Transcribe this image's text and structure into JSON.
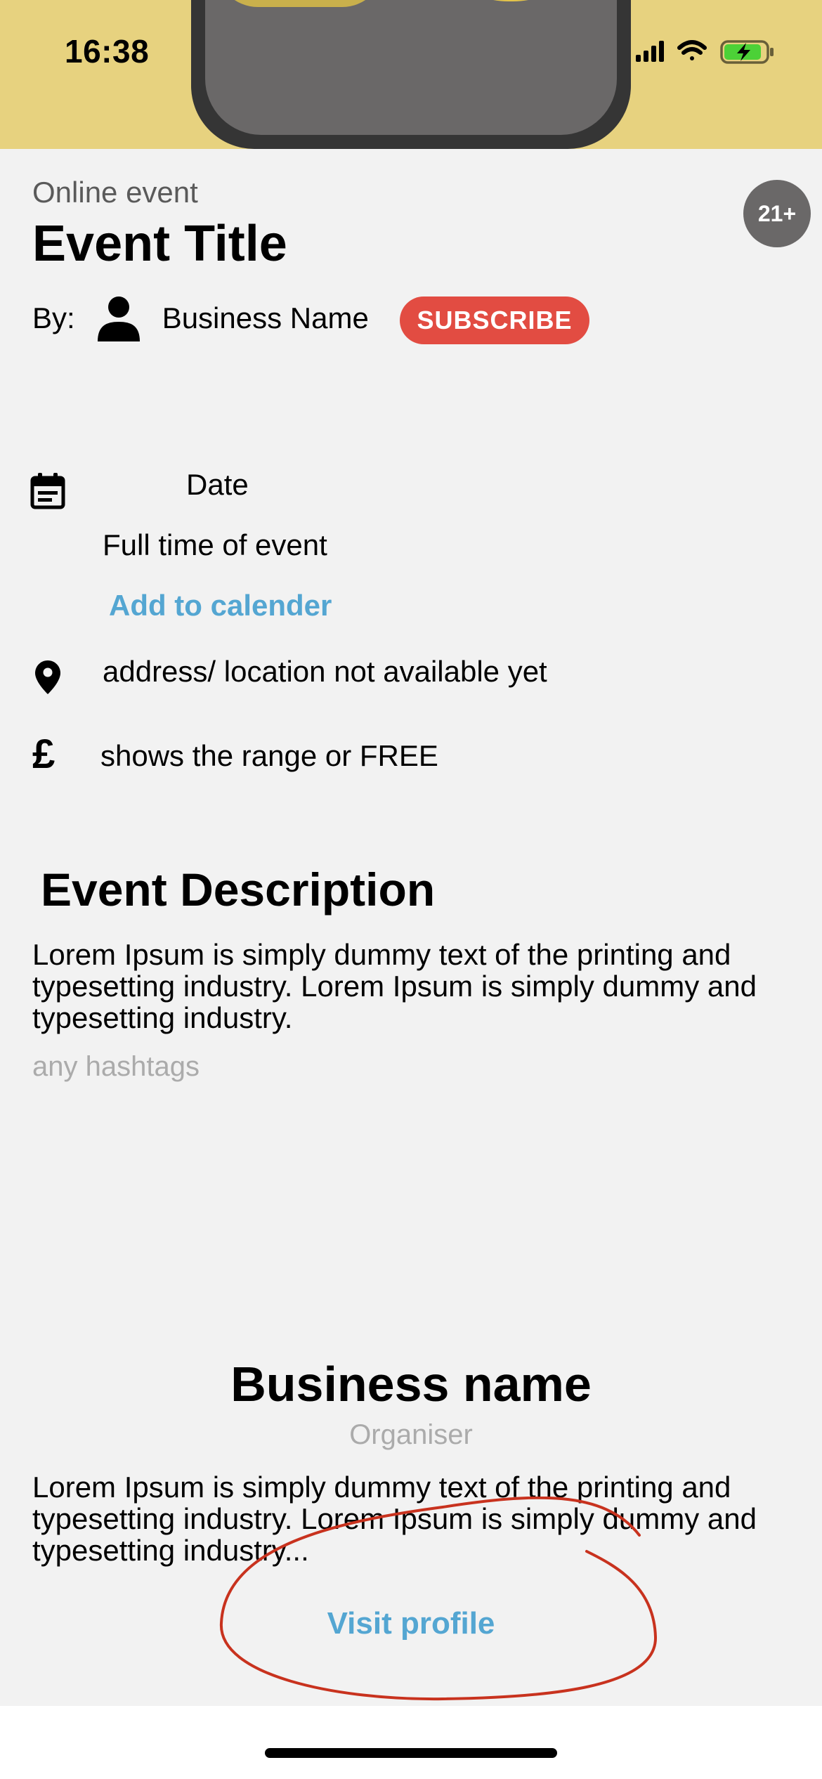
{
  "status_bar": {
    "time": "16:38"
  },
  "event": {
    "type": "Online event",
    "title": "Event Title",
    "age_badge": "21+",
    "by_label": "By:",
    "business_name": "Business Name",
    "subscribe_label": "SUBSCRIBE",
    "date": "Date",
    "full_time": "Full time of event",
    "add_to_calendar": "Add to calender",
    "address": "address/ location not available yet",
    "price_symbol": "£",
    "price": "shows the range or FREE"
  },
  "description": {
    "heading": "Event Description",
    "body": "Lorem Ipsum is simply dummy text of the printing and typesetting industry. Lorem Ipsum is simply dummy and typesetting industry.",
    "hashtags": "any hashtags"
  },
  "organiser": {
    "name": "Business name",
    "role": "Organiser",
    "body": "Lorem Ipsum is simply dummy text of the printing and typesetting industry. Lorem Ipsum is simply dummy and typesetting industry...",
    "visit_label": "Visit profile"
  },
  "colors": {
    "banner": "#e7d27f",
    "accent_red": "#e24c42",
    "link_blue": "#54a6d2",
    "annotation_red": "#c8321e"
  },
  "icons": [
    "signal-icon",
    "wifi-icon",
    "battery-charging-icon",
    "person-icon",
    "calendar-icon",
    "location-pin-icon",
    "pound-icon"
  ]
}
